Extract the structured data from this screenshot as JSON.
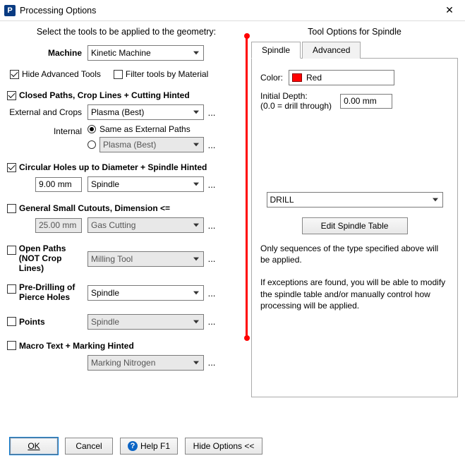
{
  "window": {
    "app_icon_letter": "P",
    "title": "Processing Options",
    "close": "✕"
  },
  "left": {
    "heading": "Select the tools to be applied to the geometry:",
    "machine_label": "Machine",
    "machine_value": "Kinetic Machine",
    "hide_adv_label": "Hide Advanced Tools",
    "hide_adv_checked": true,
    "filter_mat_label": "Filter tools by Material",
    "filter_mat_checked": false,
    "closed_label": "Closed Paths,  Crop Lines  +  Cutting Hinted",
    "closed_checked": true,
    "ext_crops_label": "External and Crops",
    "ext_crops_value": "Plasma (Best)",
    "internal_label": "Internal",
    "radio_same_label": "Same as External Paths",
    "radio_same_on": true,
    "internal_value": "Plasma (Best)",
    "circ_label": "Circular Holes up to Diameter   +  Spindle Hinted",
    "circ_checked": true,
    "circ_diam_value": "9.00 mm",
    "circ_tool_value": "Spindle",
    "gsc_label": "General Small Cutouts, Dimension <=",
    "gsc_checked": false,
    "gsc_dim_value": "25.00 mm",
    "gsc_tool_value": "Gas Cutting",
    "open_label_l1": "Open Paths",
    "open_label_l2": "(NOT Crop Lines)",
    "open_checked": false,
    "open_tool_value": "Milling Tool",
    "predrill_label_l1": "Pre-Drilling of",
    "predrill_label_l2": "Pierce Holes",
    "predrill_checked": false,
    "predrill_tool_value": "Spindle",
    "points_label": "Points",
    "points_checked": false,
    "points_tool_value": "Spindle",
    "macro_label": "Macro Text   +  Marking Hinted",
    "macro_checked": false,
    "macro_tool_value": "Marking Nitrogen",
    "dots": "..."
  },
  "right": {
    "heading": "Tool Options for Spindle",
    "tab_spindle": "Spindle",
    "tab_adv": "Advanced",
    "color_label": "Color:",
    "color_name": "Red",
    "initial_depth_l1": "Initial Depth:",
    "initial_depth_l2": "(0.0 = drill through)",
    "initial_depth_value": "0.00 mm",
    "seq_value": "DRILL",
    "edit_btn": "Edit Spindle Table",
    "note1": "Only sequences of the type specified above will be applied.",
    "note2": " If exceptions are found, you will be able to modify the spindle table and/or manually control how processing will be applied."
  },
  "buttons": {
    "ok": "OK",
    "cancel": "Cancel",
    "help": "Help F1",
    "hide_opts": "Hide Options <<"
  }
}
